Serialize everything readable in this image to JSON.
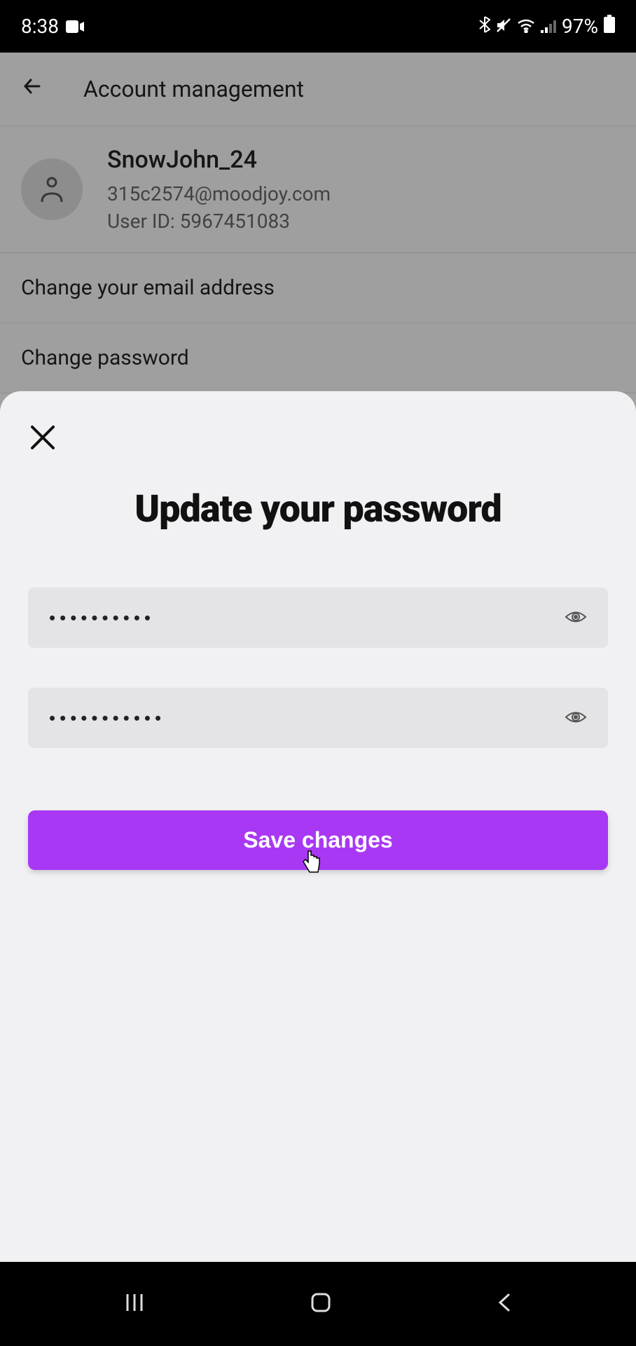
{
  "status": {
    "time": "8:38",
    "battery": "97%"
  },
  "header": {
    "title": "Account management"
  },
  "user": {
    "username": "SnowJohn_24",
    "email": "315c2574@moodjoy.com",
    "id_label": "User ID: 5967451083"
  },
  "menu": {
    "change_email": "Change your email address",
    "change_password": "Change password"
  },
  "modal": {
    "title": "Update your password",
    "password1": "••••••••••",
    "password2": "•••••••••••",
    "save_label": "Save changes"
  }
}
